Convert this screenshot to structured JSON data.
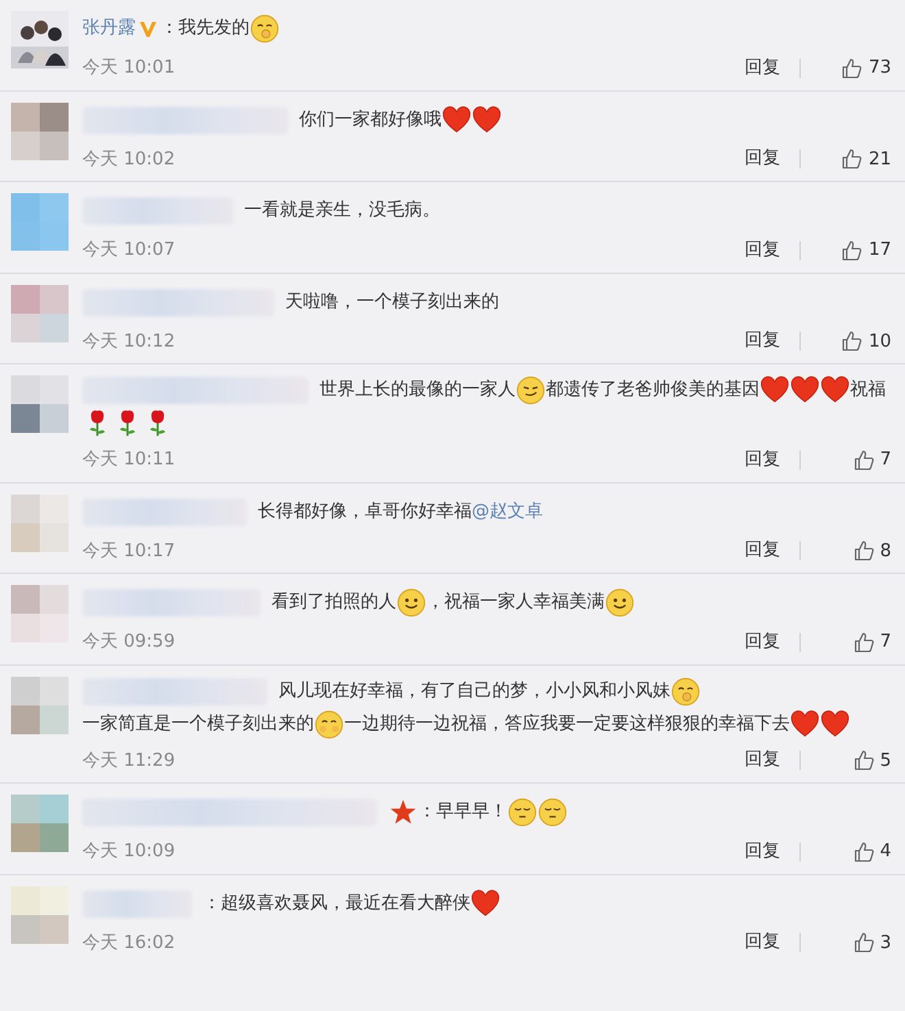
{
  "comments": [
    {
      "name": "张丹露",
      "verified": true,
      "parts": [
        {
          "kind": "text",
          "text": "：我先发的"
        },
        {
          "kind": "grin"
        }
      ],
      "time": "今天 10:01",
      "reply": "回复",
      "likes": "73"
    },
    {
      "parts": [
        {
          "kind": "text",
          "text": "你们一家都好像哦"
        },
        {
          "kind": "heart"
        },
        {
          "kind": "heart"
        }
      ],
      "time": "今天 10:02",
      "reply": "回复",
      "likes": "21"
    },
    {
      "parts": [
        {
          "kind": "text",
          "text": "一看就是亲生，没毛病。"
        }
      ],
      "time": "今天 10:07",
      "reply": "回复",
      "likes": "17"
    },
    {
      "parts": [
        {
          "kind": "text",
          "text": "天啦噜，一个模子刻出来的"
        }
      ],
      "time": "今天 10:12",
      "reply": "回复",
      "likes": "10"
    },
    {
      "parts": [
        {
          "kind": "text",
          "text": "世界上长的最像的一家人"
        },
        {
          "kind": "smirk"
        },
        {
          "kind": "text",
          "text": "都遗传了老爸帅俊美的基因"
        },
        {
          "kind": "heart"
        },
        {
          "kind": "heart"
        },
        {
          "kind": "heart"
        },
        {
          "kind": "text",
          "text": "祝福"
        },
        {
          "kind": "rose"
        },
        {
          "kind": "rose"
        },
        {
          "kind": "rose"
        }
      ],
      "time": "今天 10:11",
      "reply": "回复",
      "likes": "7"
    },
    {
      "parts": [
        {
          "kind": "text",
          "text": "长得都好像，卓哥你好幸福"
        },
        {
          "kind": "mention",
          "text": "@赵文卓"
        }
      ],
      "time": "今天 10:17",
      "reply": "回复",
      "likes": "8"
    },
    {
      "parts": [
        {
          "kind": "text",
          "text": "看到了拍照的人"
        },
        {
          "kind": "smile"
        },
        {
          "kind": "text",
          "text": "，祝福一家人幸福美满"
        },
        {
          "kind": "smile"
        }
      ],
      "time": "今天 09:59",
      "reply": "回复",
      "likes": "7"
    },
    {
      "parts": [
        {
          "kind": "text",
          "text": "风儿现在好幸福，有了自己的梦，小小风和小风妹"
        },
        {
          "kind": "grin"
        },
        {
          "kind": "text",
          "text": "一家简直是一个模子刻出来的"
        },
        {
          "kind": "shy"
        },
        {
          "kind": "text",
          "text": "一边期待一边祝福，答应我要一定要这样狠狠的幸福下去"
        },
        {
          "kind": "heart"
        },
        {
          "kind": "heart"
        }
      ],
      "time": "今天 11:29",
      "reply": "回复",
      "likes": "5"
    },
    {
      "parts": [
        {
          "kind": "star"
        },
        {
          "kind": "text",
          "text": "：早早早！"
        },
        {
          "kind": "sleepy"
        },
        {
          "kind": "sleepy"
        }
      ],
      "time": "今天 10:09",
      "reply": "回复",
      "likes": "4"
    },
    {
      "parts": [
        {
          "kind": "text",
          "text": "：超级喜欢聂风，最近在看大醉侠"
        },
        {
          "kind": "heart"
        }
      ],
      "time": "今天 16:02",
      "reply": "回复",
      "likes": "3"
    }
  ]
}
